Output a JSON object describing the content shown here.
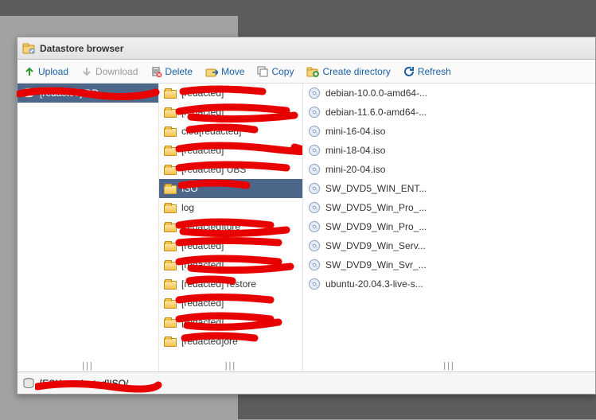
{
  "title": "Datastore browser",
  "toolbar": {
    "upload": "Upload",
    "download": "Download",
    "delete": "Delete",
    "move": "Move",
    "copy": "Copy",
    "createdir": "Create directory",
    "refresh": "Refresh"
  },
  "col1": {
    "items": [
      "[redacted] DD"
    ]
  },
  "col2": {
    "items": [
      "[redacted]",
      "[redacted]",
      "clou[redacted]",
      "[redacted]",
      "[redacted] UBS",
      "ISO",
      "log",
      "[redacted]ture",
      "[redacted]",
      "[redacted]",
      "[redacted] restore",
      "[redacted]",
      "[redacted]",
      "[redacted]ore"
    ],
    "selectedIndex": 5
  },
  "col3": {
    "items": [
      "debian-10.0.0-amd64-...",
      "debian-11.6.0-amd64-...",
      "mini-16-04.iso",
      "mini-18-04.iso",
      "mini-20-04.iso",
      "SW_DVD5_WIN_ENT...",
      "SW_DVD5_Win_Pro_...",
      "SW_DVD9_Win_Pro_...",
      "SW_DVD9_Win_Serv...",
      "SW_DVD9_Win_Svr_...",
      "ubuntu-20.04.3-live-s..."
    ]
  },
  "footer": {
    "path": "[ESX...redacted]ISO/"
  }
}
